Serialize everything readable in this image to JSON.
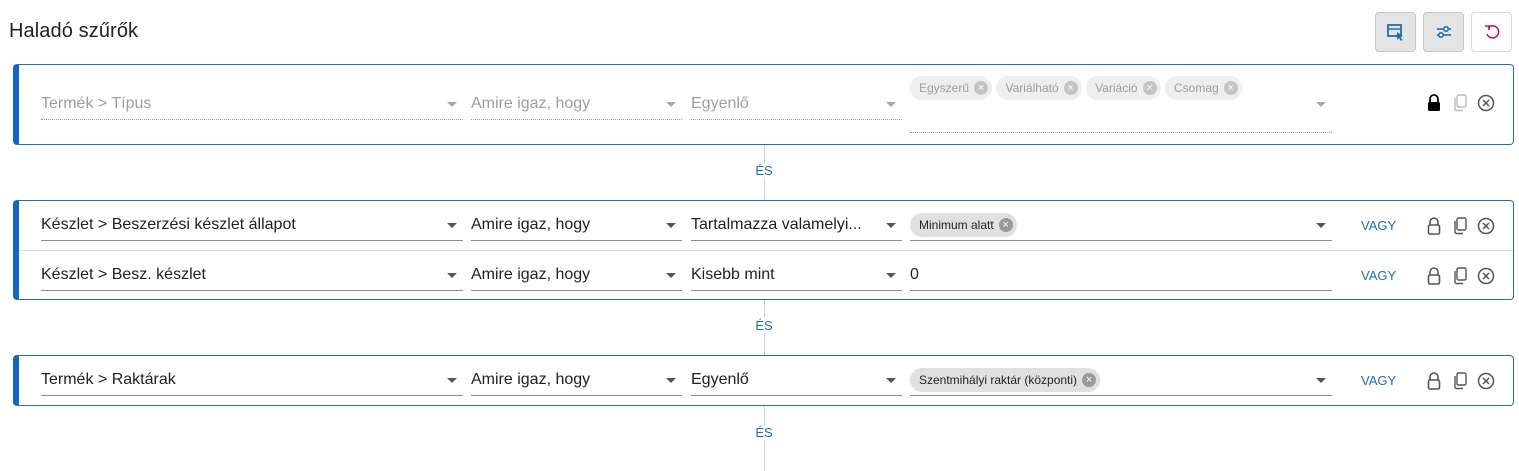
{
  "page": {
    "title": "Haladó szűrők"
  },
  "toolbar": {
    "buttons": [
      {
        "name": "apply-filter-button",
        "icon": "filter-apply-icon"
      },
      {
        "name": "filter-settings-button",
        "icon": "sliders-icon"
      },
      {
        "name": "reset-button",
        "icon": "undo-icon"
      }
    ]
  },
  "connector_label": "ÉS",
  "groups": [
    {
      "locked": true,
      "disabled": true,
      "rows": [
        {
          "field": "Termék > Típus",
          "quantifier": "Amire igaz, hogy",
          "operator": "Egyenlő",
          "values": [
            "Egyszerű",
            "Variálható",
            "Variáció",
            "Csomag"
          ],
          "or_label": ""
        }
      ]
    },
    {
      "locked": false,
      "disabled": false,
      "rows": [
        {
          "field": "Készlet > Beszerzési készlet állapot",
          "quantifier": "Amire igaz, hogy",
          "operator": "Tartalmazza valamelyi...",
          "values": [
            "Minimum alatt"
          ],
          "or_label": "VAGY"
        },
        {
          "field": "Készlet > Besz. készlet",
          "quantifier": "Amire igaz, hogy",
          "operator": "Kisebb mint",
          "text_value": "0",
          "or_label": "VAGY"
        }
      ]
    },
    {
      "locked": false,
      "disabled": false,
      "rows": [
        {
          "field": "Termék > Raktárak",
          "quantifier": "Amire igaz, hogy",
          "operator": "Egyenlő",
          "values": [
            "Szentmihályi raktár (központi)"
          ],
          "or_label": "VAGY"
        }
      ]
    }
  ],
  "colors": {
    "accent": "#1565c0",
    "link": "#1f6fb0",
    "reset": "#c2185b"
  }
}
